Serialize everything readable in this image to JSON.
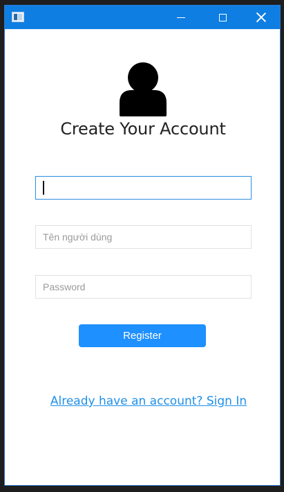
{
  "window": {
    "app_icon": "java-app-icon",
    "controls": {
      "minimize": "minimize-icon",
      "maximize": "maximize-icon",
      "close": "close-icon"
    }
  },
  "header": {
    "avatar_icon": "user-icon",
    "title": "Create Your Account"
  },
  "form": {
    "field1": {
      "value": "",
      "placeholder": ""
    },
    "username": {
      "value": "",
      "placeholder": "Tên người dùng"
    },
    "password": {
      "value": "",
      "placeholder": "Password"
    },
    "register_label": "Register"
  },
  "footer": {
    "signin_link": "Already have an account? Sign In"
  },
  "colors": {
    "titlebar": "#0f7ee2",
    "button": "#1e90ff",
    "link": "#1e8fe8",
    "focus_border": "#2b8de0"
  }
}
